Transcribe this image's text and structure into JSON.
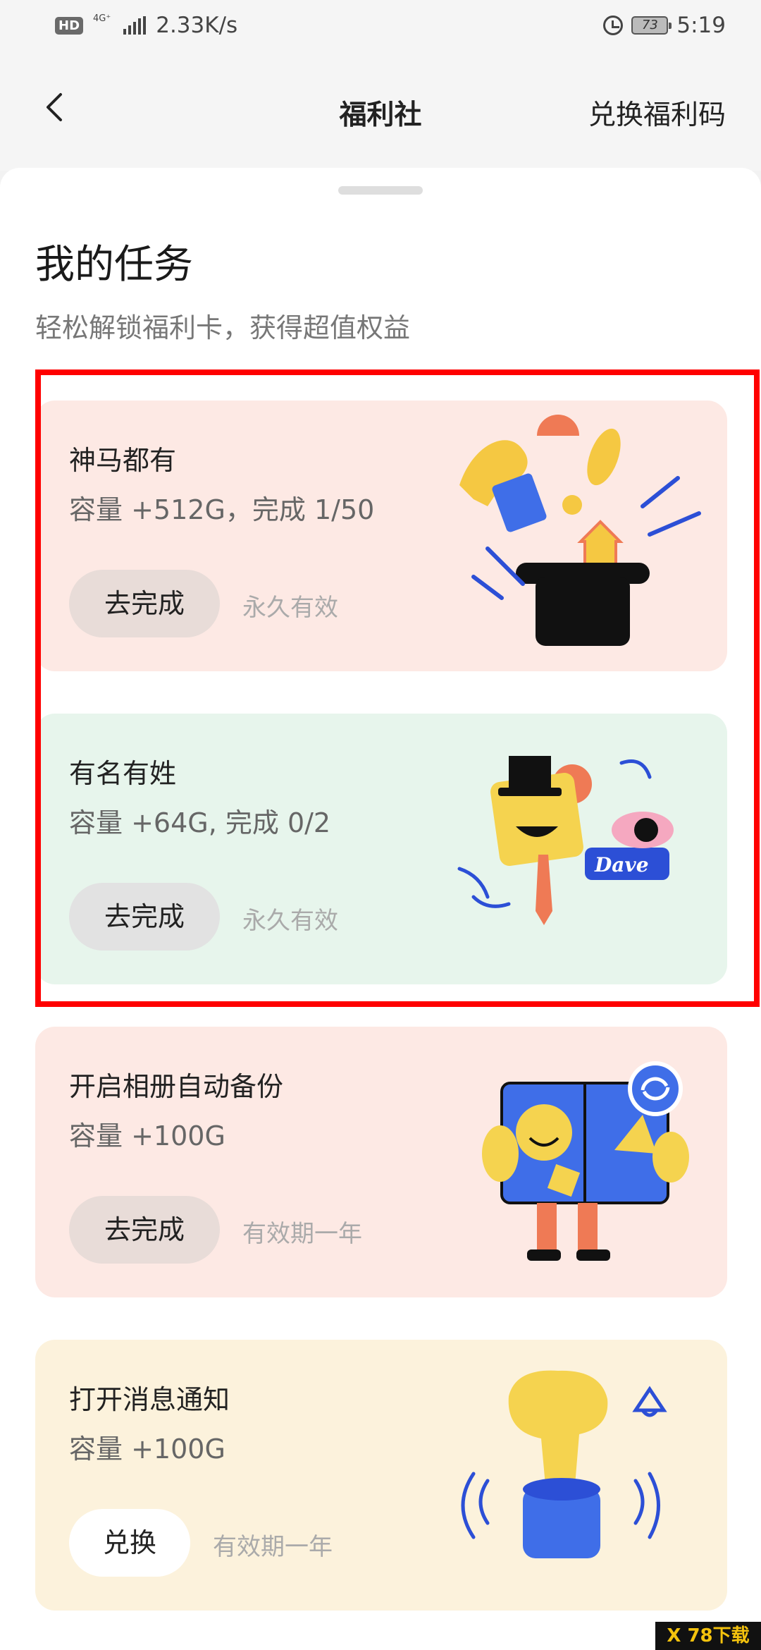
{
  "status_bar": {
    "hd": "HD",
    "network": "4G⁺",
    "speed": "2.33K/s",
    "battery": "73",
    "time": "5:19"
  },
  "nav": {
    "title": "福利社",
    "redeem_label": "兑换福利码"
  },
  "section": {
    "title": "我的任务",
    "subtitle": "轻松解锁福利卡，获得超值权益"
  },
  "tasks": [
    {
      "name": "神马都有",
      "desc": "容量 +512G，完成 1/50",
      "button": "去完成",
      "validity": "永久有效"
    },
    {
      "name": "有名有姓",
      "desc": "容量 +64G, 完成 0/2",
      "button": "去完成",
      "validity": "永久有效",
      "badge": "Dave"
    },
    {
      "name": "开启相册自动备份",
      "desc": "容量 +100G",
      "button": "去完成",
      "validity": "有效期一年"
    },
    {
      "name": "打开消息通知",
      "desc": "容量 +100G",
      "button": "兑换",
      "validity": "有效期一年"
    }
  ],
  "watermark": "X 78下载",
  "colors": {
    "highlight": "#ff0000",
    "card_pink": "#fde9e4",
    "card_green": "#e7f5ec",
    "card_yellow": "#fcf2dc"
  }
}
